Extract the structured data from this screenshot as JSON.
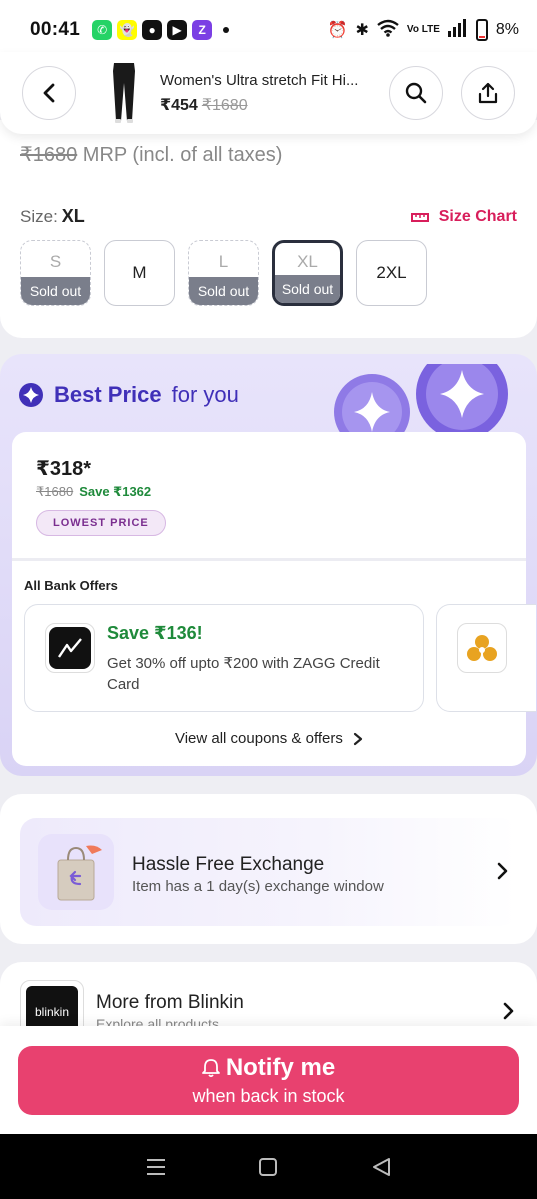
{
  "status_bar": {
    "time": "00:41",
    "battery": "8%",
    "network": "Vo LTE"
  },
  "header": {
    "title": "Women's Ultra stretch Fit Hi...",
    "price": "₹454",
    "mrp": "₹1680"
  },
  "product": {
    "mrp_value": "₹1680",
    "mrp_suffix": "MRP (incl. of all taxes)"
  },
  "size": {
    "label": "Size:",
    "selected": "XL",
    "chart_label": "Size Chart",
    "options": [
      {
        "name": "S",
        "status": "Sold out"
      },
      {
        "name": "M",
        "status": ""
      },
      {
        "name": "L",
        "status": "Sold out"
      },
      {
        "name": "XL",
        "status": "Sold out"
      },
      {
        "name": "2XL",
        "status": ""
      }
    ]
  },
  "best_price": {
    "title_bold": "Best Price",
    "title_light": "for you",
    "price": "₹318*",
    "mrp": "₹1680",
    "save": "Save ₹1362",
    "badge": "LOWEST PRICE",
    "bank_offers_label": "All Bank Offers",
    "offer": {
      "save": "Save ₹136!",
      "description": "Get 30% off upto  ₹200 with ZAGG Credit Card"
    },
    "view_all": "View all coupons & offers"
  },
  "exchange": {
    "title": "Hassle Free Exchange",
    "subtitle": "Item has a 1 day(s) exchange window"
  },
  "more_from": {
    "title": "More from Blinkin",
    "subtitle": "Explore all products",
    "logo_text": "blinkin"
  },
  "notify": {
    "title": "Notify me",
    "subtitle": "when back in stock"
  },
  "colors": {
    "accent_pink": "#e8416f",
    "brand_purple": "#4030b8",
    "save_green": "#1f8a3b",
    "size_chart_red": "#d81e5b"
  }
}
